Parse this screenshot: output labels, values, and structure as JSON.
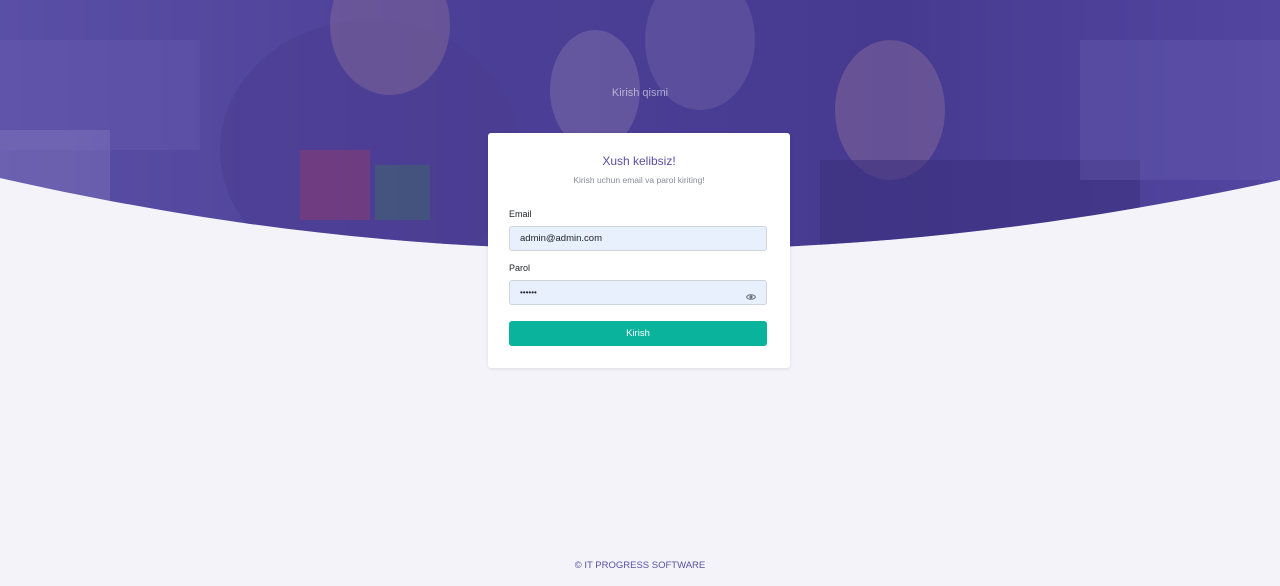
{
  "header": {
    "heading": "Kirish qismi"
  },
  "login_card": {
    "title": "Xush kelibsiz!",
    "subtitle": "Kirish uchun email va parol kiriting!",
    "email_label": "Email",
    "email_value": "admin@admin.com",
    "password_label": "Parol",
    "password_masked": "••••••",
    "password_toggle_icon": "eye-icon",
    "submit_label": "Kirish"
  },
  "footer": {
    "text": "© IT PROGRESS SOFTWARE"
  },
  "colors": {
    "hero_overlay": "#4b3e96",
    "background": "#f3f3f9",
    "accent": "#5a4fa2",
    "button": "#0ab39c",
    "input_fill": "#e8f0fe"
  }
}
